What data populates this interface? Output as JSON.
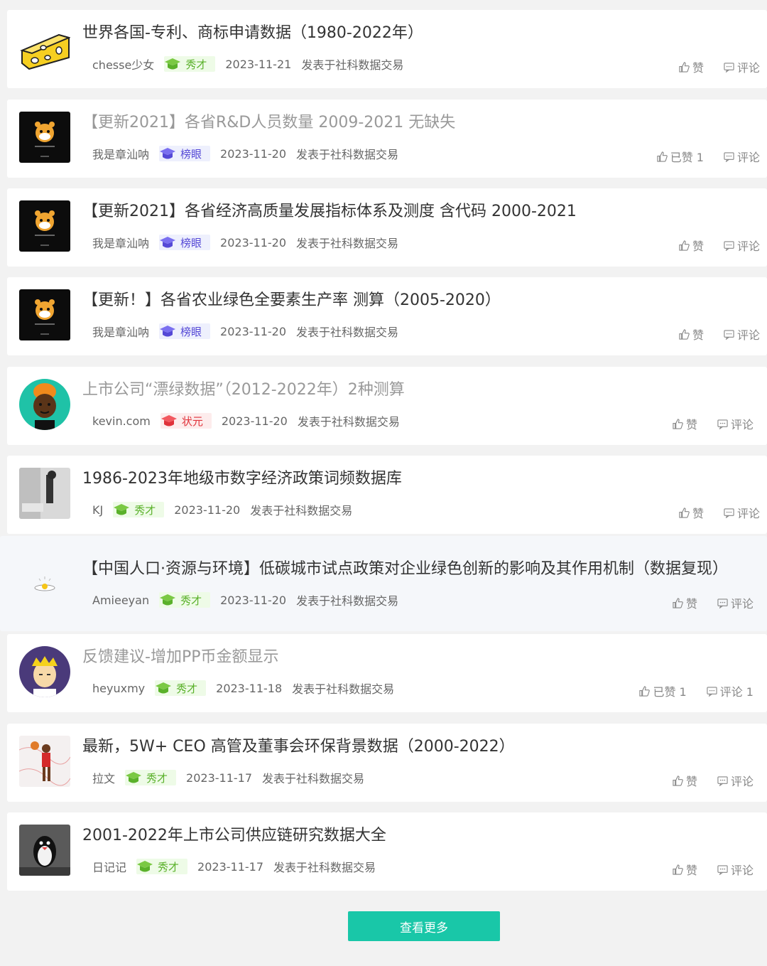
{
  "posts": [
    {
      "title": "世界各国-专利、商标申请数据（1980-2022年）",
      "title_visited": false,
      "author": "chesse少女",
      "rank": "秀才",
      "rank_type": "xiucai",
      "date": "2023-11-21",
      "source": "发表于社科数据交易",
      "like": "赞",
      "comment": "评论",
      "avatar": "cheese-avatar",
      "highlight": false
    },
    {
      "title": "【更新2021】各省R&D人员数量 2009-2021 无缺失",
      "title_visited": true,
      "author": "我是章汕呐",
      "rank": "榜眼",
      "rank_type": "bangyan",
      "date": "2023-11-20",
      "source": "发表于社科数据交易",
      "like": "已赞 1",
      "comment": "评论",
      "avatar": "tiger-avatar",
      "highlight": false
    },
    {
      "title": "【更新2021】各省经济高质量发展指标体系及测度 含代码 2000-2021",
      "title_visited": false,
      "author": "我是章汕呐",
      "rank": "榜眼",
      "rank_type": "bangyan",
      "date": "2023-11-20",
      "source": "发表于社科数据交易",
      "like": "赞",
      "comment": "评论",
      "avatar": "tiger-avatar",
      "highlight": false
    },
    {
      "title": "【更新！】各省农业绿色全要素生产率 测算（2005-2020）",
      "title_visited": false,
      "author": "我是章汕呐",
      "rank": "榜眼",
      "rank_type": "bangyan",
      "date": "2023-11-20",
      "source": "发表于社科数据交易",
      "like": "赞",
      "comment": "评论",
      "avatar": "tiger-avatar",
      "highlight": false
    },
    {
      "title": "上市公司“漂绿数据”（2012-2022年）2种测算",
      "title_visited": true,
      "author": "kevin.com",
      "rank": "状元",
      "rank_type": "zhuangyuan",
      "date": "2023-11-20",
      "source": "发表于社科数据交易",
      "like": "赞",
      "comment": "评论",
      "avatar": "face-avatar",
      "highlight": false
    },
    {
      "title": "1986-2023年地级市数字经济政策词频数据库",
      "title_visited": false,
      "author": "KJ",
      "rank": "秀才",
      "rank_type": "xiucai",
      "date": "2023-11-20",
      "source": "发表于社科数据交易",
      "like": "赞",
      "comment": "评论",
      "avatar": "photo-avatar",
      "highlight": false
    },
    {
      "title": "【中国人口·资源与环境】低碳城市试点政策对企业绿色创新的影响及其作用机制（数据复现）",
      "title_visited": false,
      "author": "Amieeyan",
      "rank": "秀才",
      "rank_type": "xiucai",
      "date": "2023-11-20",
      "source": "发表于社科数据交易",
      "like": "赞",
      "comment": "评论",
      "avatar": "egg-avatar",
      "highlight": true
    },
    {
      "title": "反馈建议-增加PP币金额显示",
      "title_visited": true,
      "author": "heyuxmy",
      "rank": "秀才",
      "rank_type": "xiucai",
      "date": "2023-11-18",
      "source": "发表于社科数据交易",
      "like": "已赞 1",
      "comment": "评论 1",
      "avatar": "cartoon-avatar",
      "highlight": false
    },
    {
      "title": "最新，5W+ CEO 高管及董事会环保背景数据（2000-2022）",
      "title_visited": false,
      "author": "拉文",
      "rank": "秀才",
      "rank_type": "xiucai",
      "date": "2023-11-17",
      "source": "发表于社科数据交易",
      "like": "赞",
      "comment": "评论",
      "avatar": "basketball-avatar",
      "highlight": false
    },
    {
      "title": "2001-2022年上市公司供应链研究数据大全",
      "title_visited": false,
      "author": "日记记",
      "rank": "秀才",
      "rank_type": "xiucai",
      "date": "2023-11-17",
      "source": "发表于社科数据交易",
      "like": "赞",
      "comment": "评论",
      "avatar": "penguin-avatar",
      "highlight": false
    }
  ],
  "load_more_label": "查看更多",
  "colors": {
    "accent": "#19c7a8",
    "xiucai": "#5ab12a",
    "bangyan": "#5549d6",
    "zhuangyuan": "#e0323a"
  }
}
